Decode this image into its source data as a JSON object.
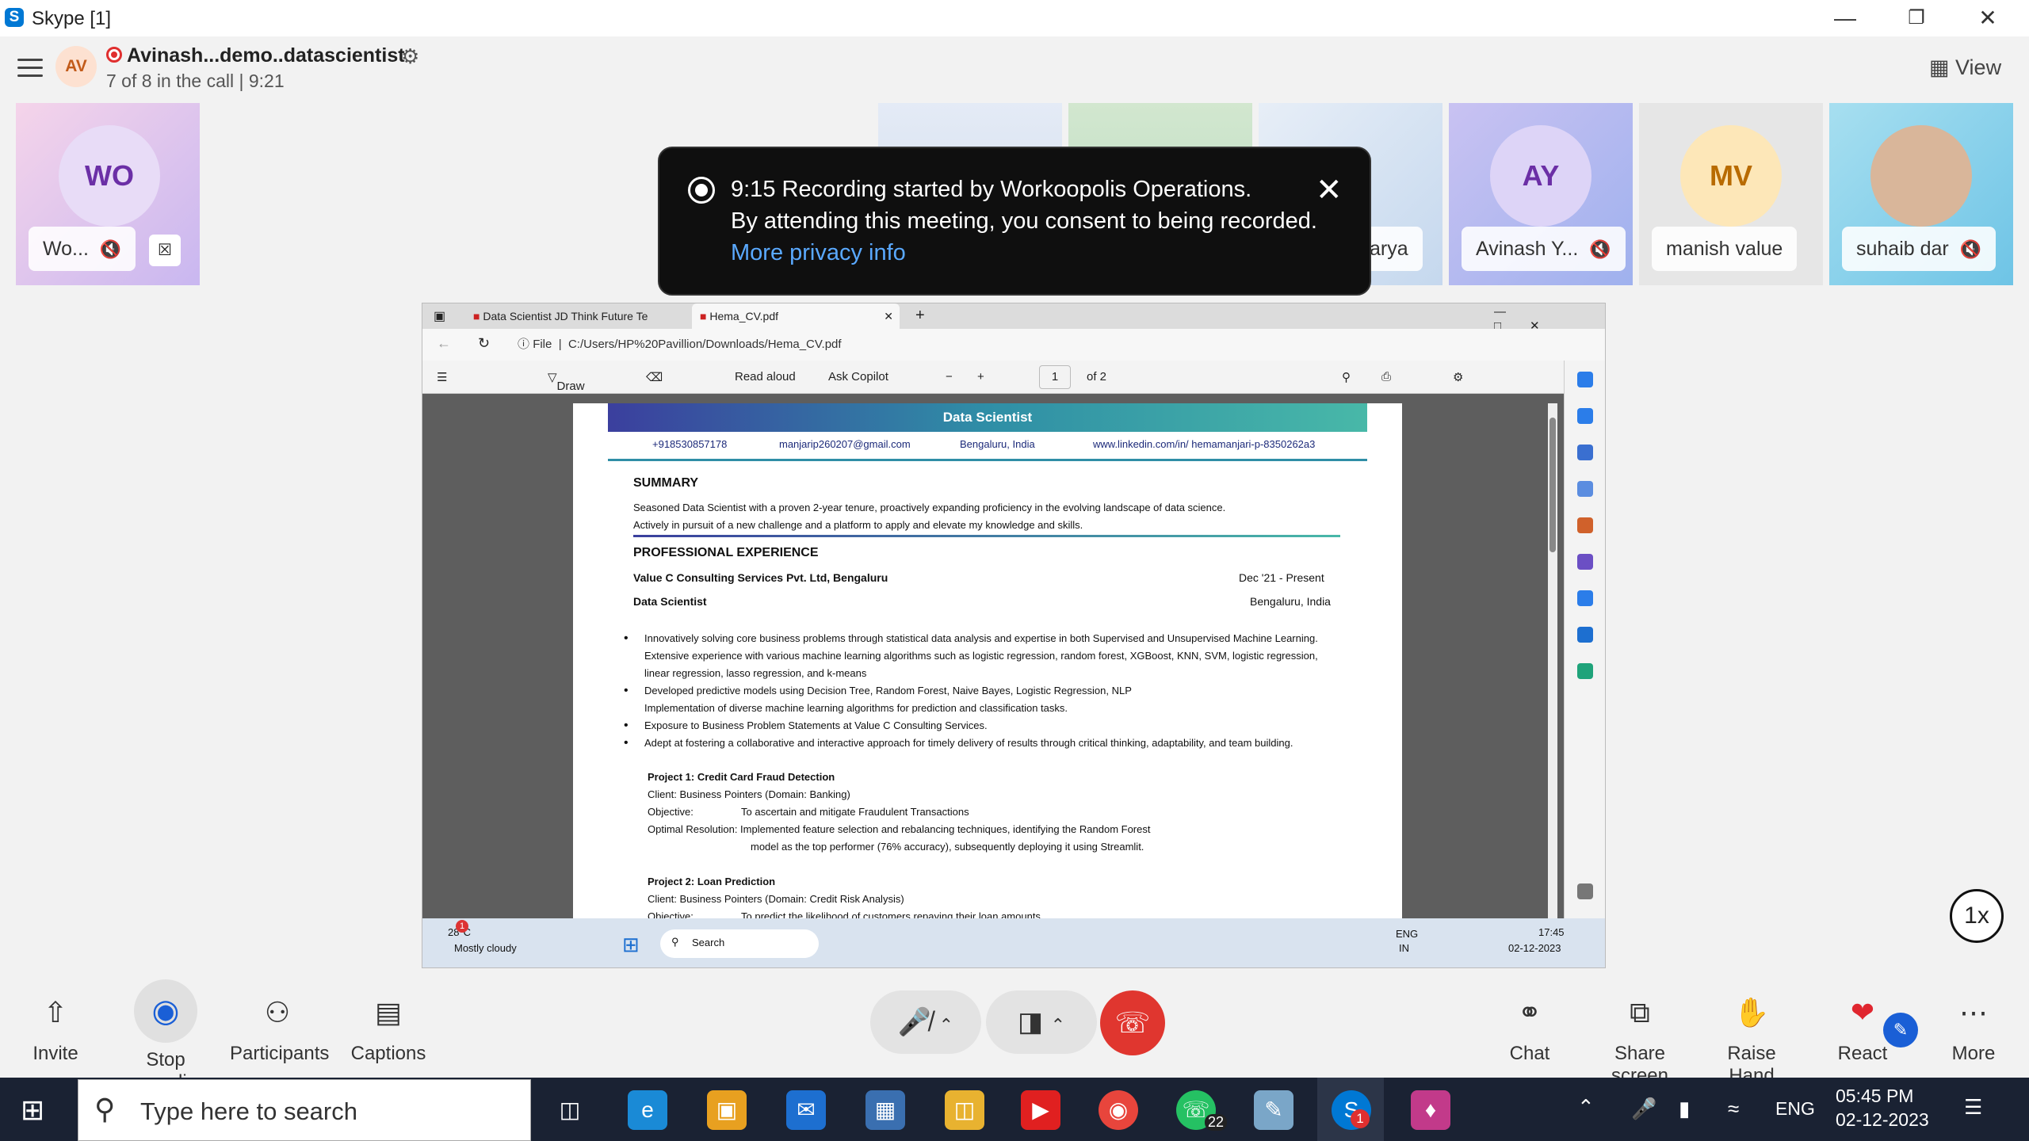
{
  "window": {
    "title": "Skype [1]",
    "logo": "S",
    "controls": [
      "minimize-icon",
      "restore-icon",
      "close-icon"
    ]
  },
  "call": {
    "avatar_initials": "AV",
    "name": "Avinash...demo..datascientist",
    "subtitle": "7 of 8 in the call | 9:21",
    "view_label": "View"
  },
  "participants": [
    {
      "initials": "WO",
      "name": "Wo...",
      "muted": true,
      "pinned": true,
      "color": "#d8c8f0",
      "text": "#6b2fa6"
    },
    {
      "initials": "",
      "name": "",
      "muted": false,
      "color": "#dde6f2"
    },
    {
      "initials": "",
      "name": "",
      "muted": false,
      "color": "#d4e8d0"
    },
    {
      "initials": "",
      "name": "arya",
      "muted": false,
      "color": "#dfe8f5"
    },
    {
      "initials": "AY",
      "name": "Avinash Y...",
      "muted": true,
      "color": "#c9c0ef",
      "text": "#6b2fa6"
    },
    {
      "initials": "MV",
      "name": "manish value",
      "muted": false,
      "color": "#e5e5e5",
      "text": "#b86b00"
    },
    {
      "initials": "",
      "name": "suhaib dar",
      "muted": true,
      "color": "#bfe2f0"
    }
  ],
  "notification": {
    "line1": "9:15 Recording started by Workoopolis Operations.",
    "line2": "By attending this meeting, you consent to being recorded.",
    "link": "More privacy info"
  },
  "browser": {
    "tabs": [
      "Data Scientist JD Think Future Te",
      "Hema_CV.pdf"
    ],
    "address_prefix": "File",
    "url": "C:/Users/HP%20Pavillion/Downloads/Hema_CV.pdf",
    "toolbar": {
      "draw": "Draw",
      "read_aloud": "Read aloud",
      "ask_copilot": "Ask Copilot",
      "page": "1",
      "of_pages": "of 2"
    }
  },
  "cv": {
    "title": "Data Scientist",
    "phone": "+918530857178",
    "email": "manjarip260207@gmail.com",
    "location": "Bengaluru, India",
    "linkedin": "www.linkedin.com/in/ hemamanjari-p-8350262a3",
    "summary_h": "SUMMARY",
    "summary_1": "Seasoned Data Scientist with a proven 2-year tenure, proactively expanding proficiency in the evolving landscape of data science.",
    "summary_2": "Actively in pursuit of a new challenge and a platform to apply and elevate my knowledge and skills.",
    "exp_h": "PROFESSIONAL  EXPERIENCE",
    "company": "Value C Consulting Services Pvt. Ltd, Bengaluru",
    "dates": "Dec '21 - Present",
    "role": "Data Scientist",
    "role_loc": "Bengaluru, India",
    "bullets": [
      "Innovatively solving core business problems through statistical data analysis and expertise in both Supervised and Unsupervised Machine Learning. Extensive experience with various machine learning algorithms such as logistic regression, random forest, XGBoost, KNN, SVM, logistic regression, linear regression, lasso regression, and k-means",
      "Developed predictive models using Decision Tree, Random Forest, Naive Bayes, Logistic Regression, NLP Implementation of diverse machine learning algorithms for prediction and classification tasks.",
      "Exposure to Business Problem Statements at Value C Consulting Services.",
      "Adept at fostering a collaborative and interactive approach for timely delivery of results through critical thinking, adaptability, and team building."
    ],
    "p1_title": "Project 1: Credit Card Fraud Detection",
    "p1_client": "Client: Business Pointers (Domain: Banking)",
    "p1_obj_label": "Objective:",
    "p1_obj": "To ascertain and mitigate Fraudulent Transactions",
    "p1_res_1": "Optimal Resolution: Implemented feature selection and rebalancing techniques, identifying the Random Forest",
    "p1_res_2": "model as the top performer (76% accuracy), subsequently deploying it using Streamlit.",
    "p2_title": "Project 2: Loan Prediction",
    "p2_client": "Client: Business Pointers (Domain: Credit Risk Analysis)",
    "p2_obj_label": "Objective:",
    "p2_obj": "To predict the likelihood of customers repaying their loan amounts"
  },
  "remote_taskbar": {
    "temp": "28°C",
    "weather": "Mostly cloudy",
    "badge": "1",
    "search": "Search",
    "lang1": "ENG",
    "lang2": "IN",
    "time": "17:45",
    "date": "02-12-2023"
  },
  "speed": "1x",
  "controls": {
    "invite": "Invite",
    "stop_recording": "Stop recordi...",
    "participants": "Participants",
    "captions": "Captions",
    "chat": "Chat",
    "share": "Share screen",
    "raise": "Raise Hand",
    "react": "React",
    "more": "More"
  },
  "taskbar": {
    "search_placeholder": "Type here to search",
    "whatsapp_badge": "22",
    "skype_badge": "1",
    "lang": "ENG",
    "time": "05:45 PM",
    "date": "02-12-2023"
  },
  "colors": {
    "accent": "#1a5fd6",
    "end_call": "#e0362f",
    "record": "#e02f2f",
    "react_heart": "#e0262f"
  }
}
